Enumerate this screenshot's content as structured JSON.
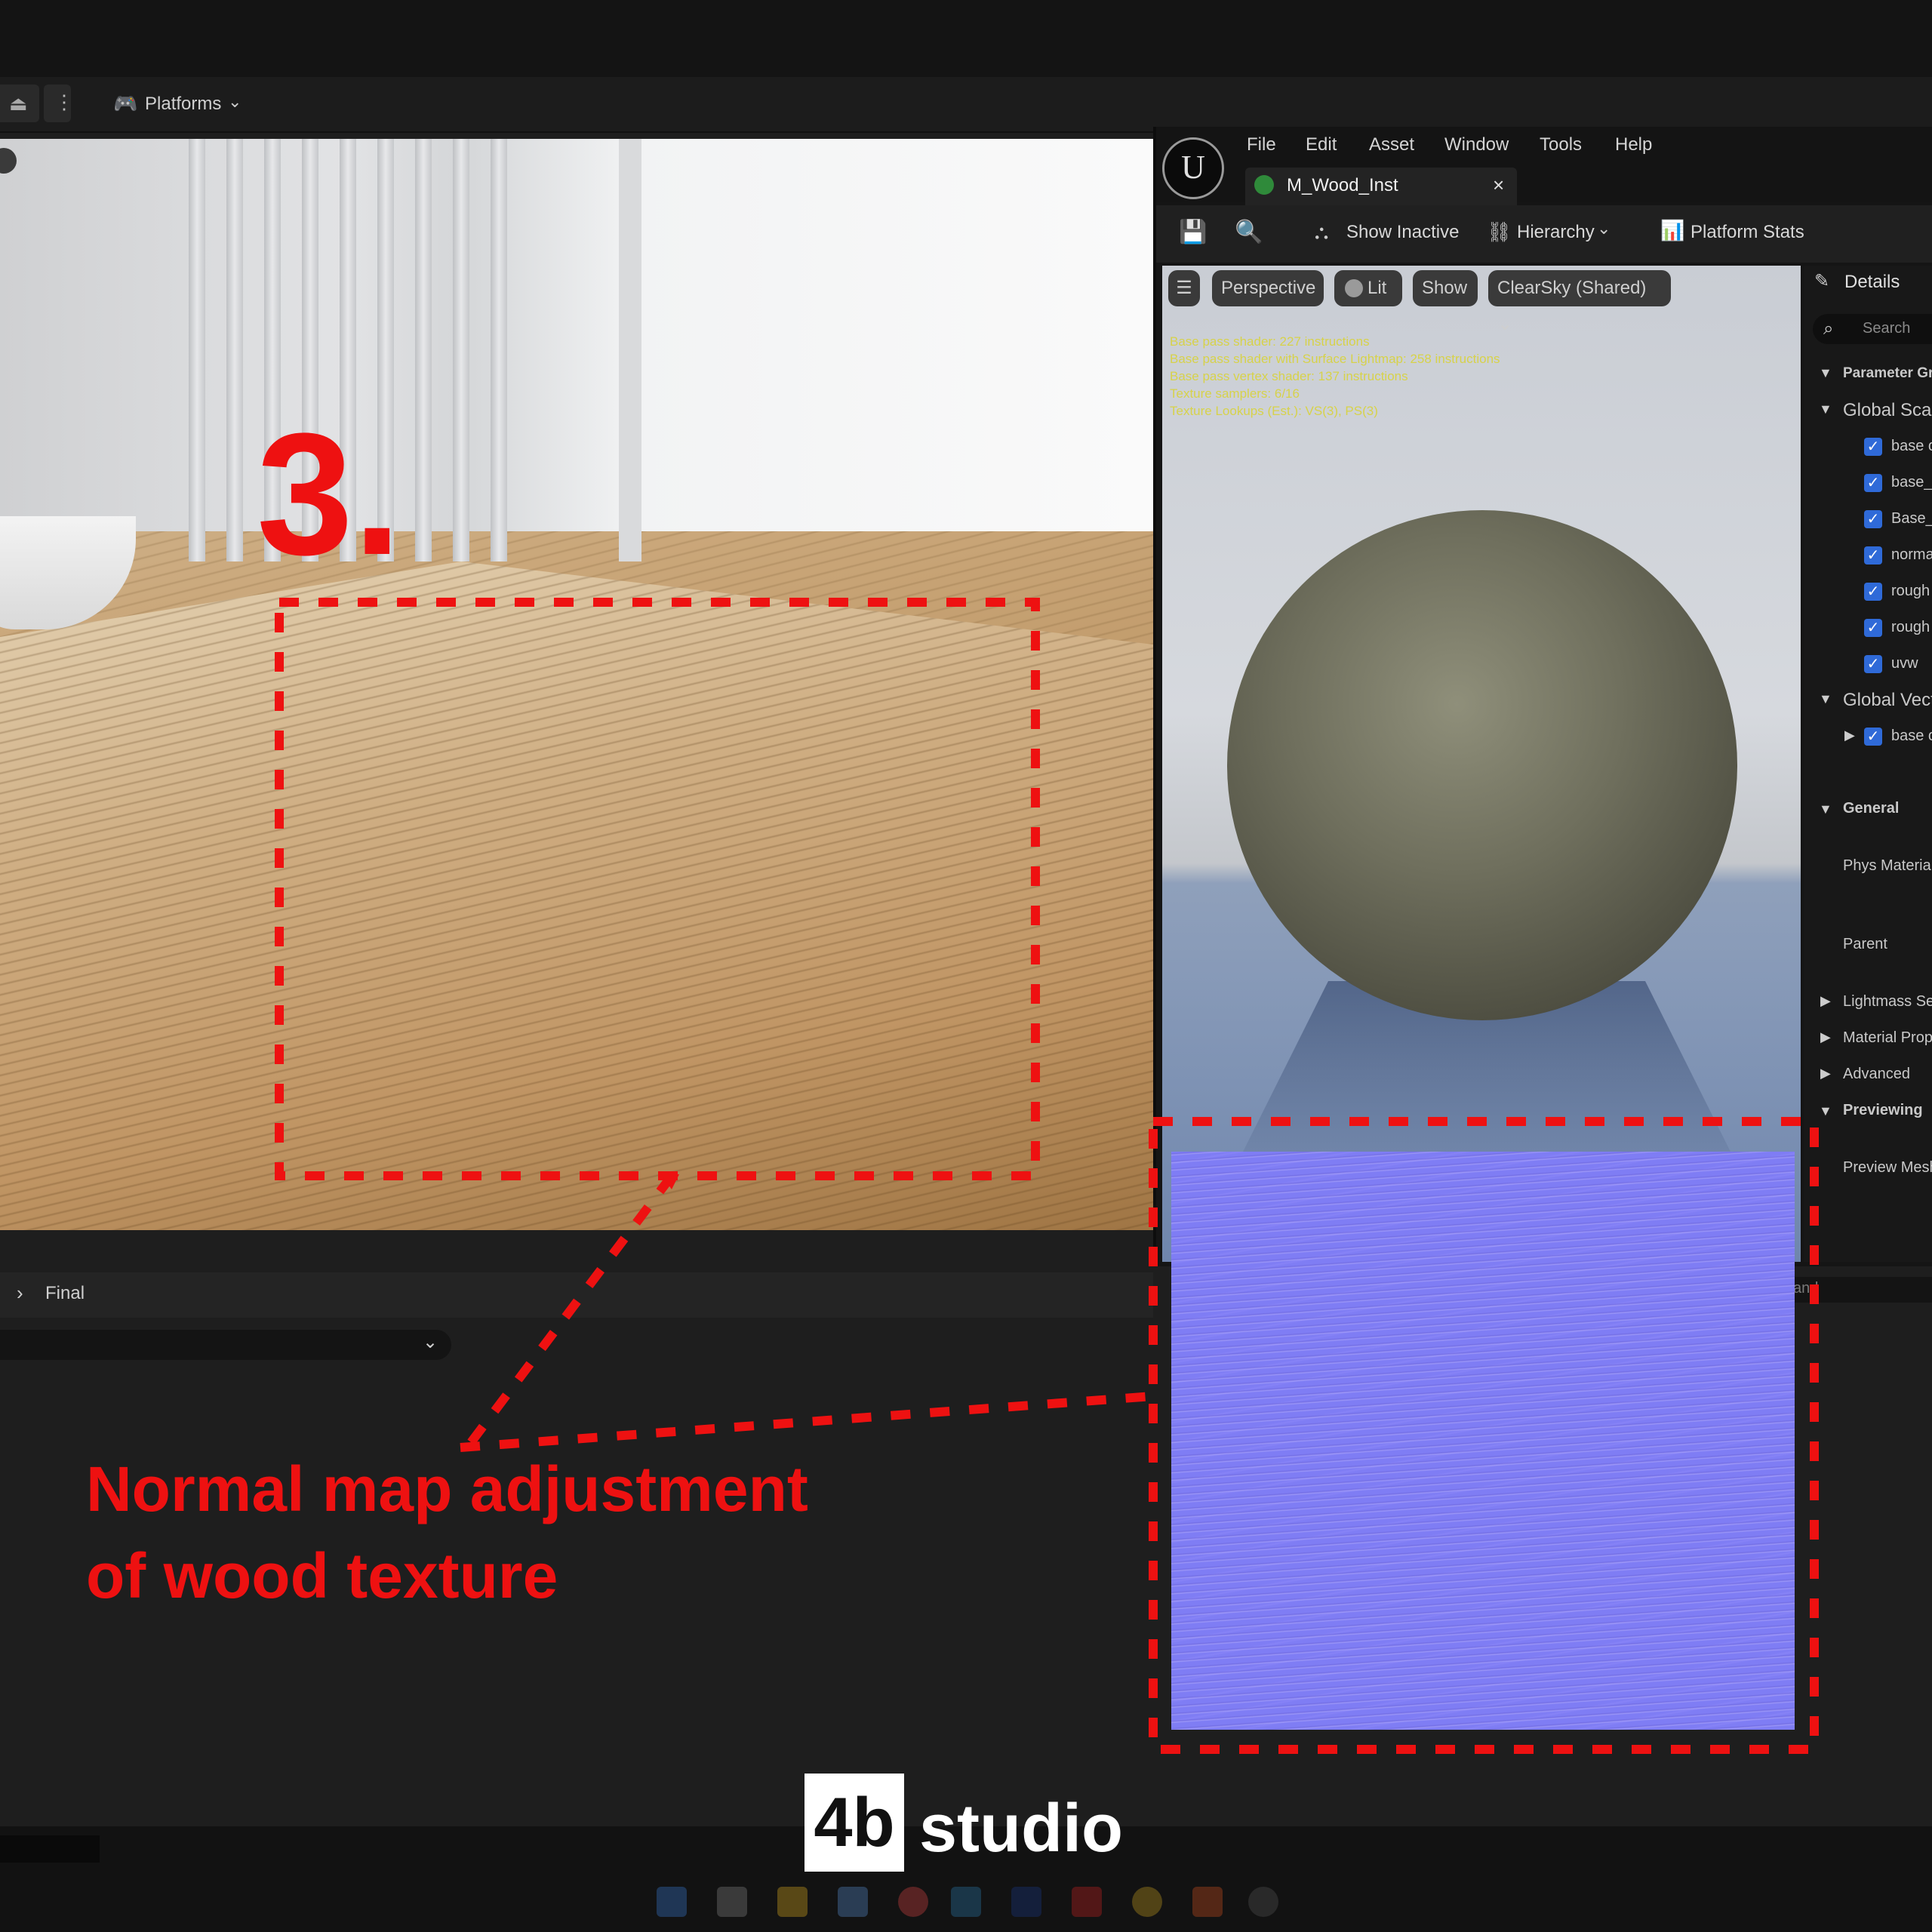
{
  "toolbar": {
    "platforms_label": "Platforms"
  },
  "editor": {
    "menu": [
      "File",
      "Edit",
      "Asset",
      "Window",
      "Tools",
      "Help"
    ],
    "tab_title": "M_Wood_Inst",
    "tab_close": "×",
    "toolbar": {
      "show_inactive": "Show Inactive",
      "hierarchy": "Hierarchy",
      "platform_stats": "Platform Stats"
    },
    "viewport": {
      "perspective": "Perspective",
      "lit": "Lit",
      "show": "Show",
      "environment": "ClearSky (Shared)",
      "stats": [
        "Base pass shader: 227 instructions",
        "Base pass shader with Surface Lightmap: 258 instructions",
        "Base pass vertex shader: 137 instructions",
        "Texture samplers: 6/16",
        "Texture Lookups (Est.): VS(3), PS(3)"
      ]
    },
    "details": {
      "title": "Details",
      "search_placeholder": "Search",
      "parameter_groups": "Parameter Gr",
      "global_scalar": "Global Scal",
      "scalar_params": [
        "base c",
        "base_i",
        "Base_",
        "norma",
        "rough",
        "rough",
        "uvw"
      ],
      "global_vector": "Global Vect",
      "vector_params": [
        "base c"
      ],
      "general": "General",
      "phys_material": "Phys Material",
      "parent": "Parent",
      "lightmass": "Lightmass Se",
      "material_props": "Material Prop",
      "advanced": "Advanced",
      "previewing": "Previewing",
      "preview_mesh": "Preview Mesh",
      "clipped_text": "and"
    }
  },
  "lower_panel": {
    "final_label": "Final"
  },
  "annotation": {
    "step_number": "3.",
    "caption_line1": "Normal map adjustment",
    "caption_line2": "of wood texture",
    "accent_color": "#ee1111"
  },
  "branding": {
    "logo_mark": "4b",
    "logo_text": "studio"
  },
  "icons": {
    "ue_logo": "U",
    "chevron": "⌄",
    "check": "✓"
  }
}
